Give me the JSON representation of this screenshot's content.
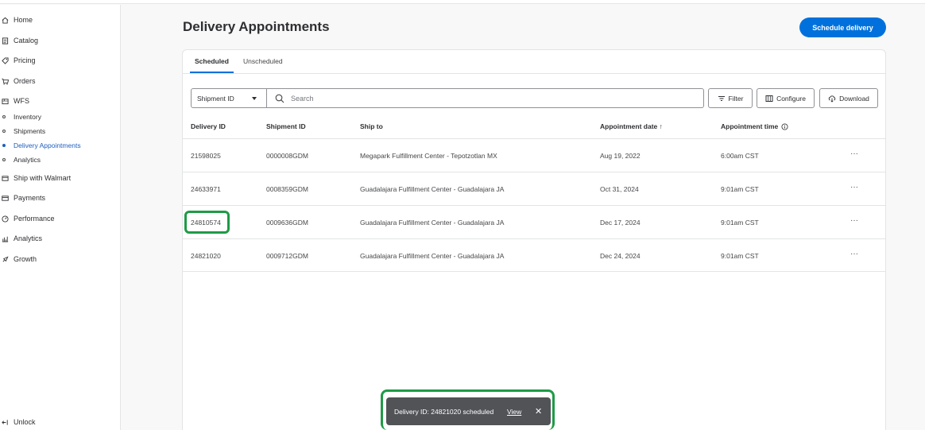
{
  "sidebar": {
    "items": [
      {
        "label": "Home",
        "icon": "home-icon"
      },
      {
        "label": "Catalog",
        "icon": "catalog-icon"
      },
      {
        "label": "Pricing",
        "icon": "tag-icon"
      },
      {
        "label": "Orders",
        "icon": "cart-icon"
      },
      {
        "label": "WFS",
        "icon": "truck-icon"
      }
    ],
    "wfs_subitems": [
      {
        "label": "Inventory"
      },
      {
        "label": "Shipments"
      },
      {
        "label": "Delivery Appointments"
      },
      {
        "label": "Analytics"
      }
    ],
    "items_lower": [
      {
        "label": "Ship with Walmart",
        "icon": "box-icon"
      },
      {
        "label": "Payments",
        "icon": "card-icon"
      },
      {
        "label": "Performance",
        "icon": "gauge-icon"
      },
      {
        "label": "Analytics",
        "icon": "chart-icon"
      },
      {
        "label": "Growth",
        "icon": "rocket-icon"
      }
    ],
    "unlock": "Unlock"
  },
  "header": {
    "title": "Delivery Appointments",
    "primary_button": "Schedule delivery"
  },
  "tabs": [
    "Scheduled",
    "Unscheduled"
  ],
  "filters": {
    "select_value": "Shipment ID",
    "search_placeholder": "Search",
    "filter_label": "Filter",
    "configure_label": "Configure",
    "download_label": "Download"
  },
  "table": {
    "columns": [
      "Delivery ID",
      "Shipment ID",
      "Ship to",
      "Appointment date ↑",
      "Appointment time"
    ],
    "rows": [
      {
        "delivery_id": "21598025",
        "shipment_id": "0000008GDM",
        "ship_to": "Megapark Fulfillment Center - Tepotzotlan MX",
        "date": "Aug 19, 2022",
        "time": "6:00am CST"
      },
      {
        "delivery_id": "24633971",
        "shipment_id": "0008359GDM",
        "ship_to": "Guadalajara Fulfillment Center - Guadalajara JA",
        "date": "Oct 31, 2024",
        "time": "9:01am CST"
      },
      {
        "delivery_id": "24810574",
        "shipment_id": "0009636GDM",
        "ship_to": "Guadalajara Fulfillment Center - Guadalajara JA",
        "date": "Dec 17, 2024",
        "time": "9:01am CST"
      },
      {
        "delivery_id": "24821020",
        "shipment_id": "0009712GDM",
        "ship_to": "Guadalajara Fulfillment Center - Guadalajara JA",
        "date": "Dec 24, 2024",
        "time": "9:01am CST"
      }
    ],
    "row_action": "···"
  },
  "toast": {
    "message": "Delivery ID: 24821020 scheduled",
    "action": "View",
    "close": "✕"
  },
  "colors": {
    "accent": "#0071dc",
    "highlight": "#1f9b46",
    "toast_bg": "#515357"
  }
}
